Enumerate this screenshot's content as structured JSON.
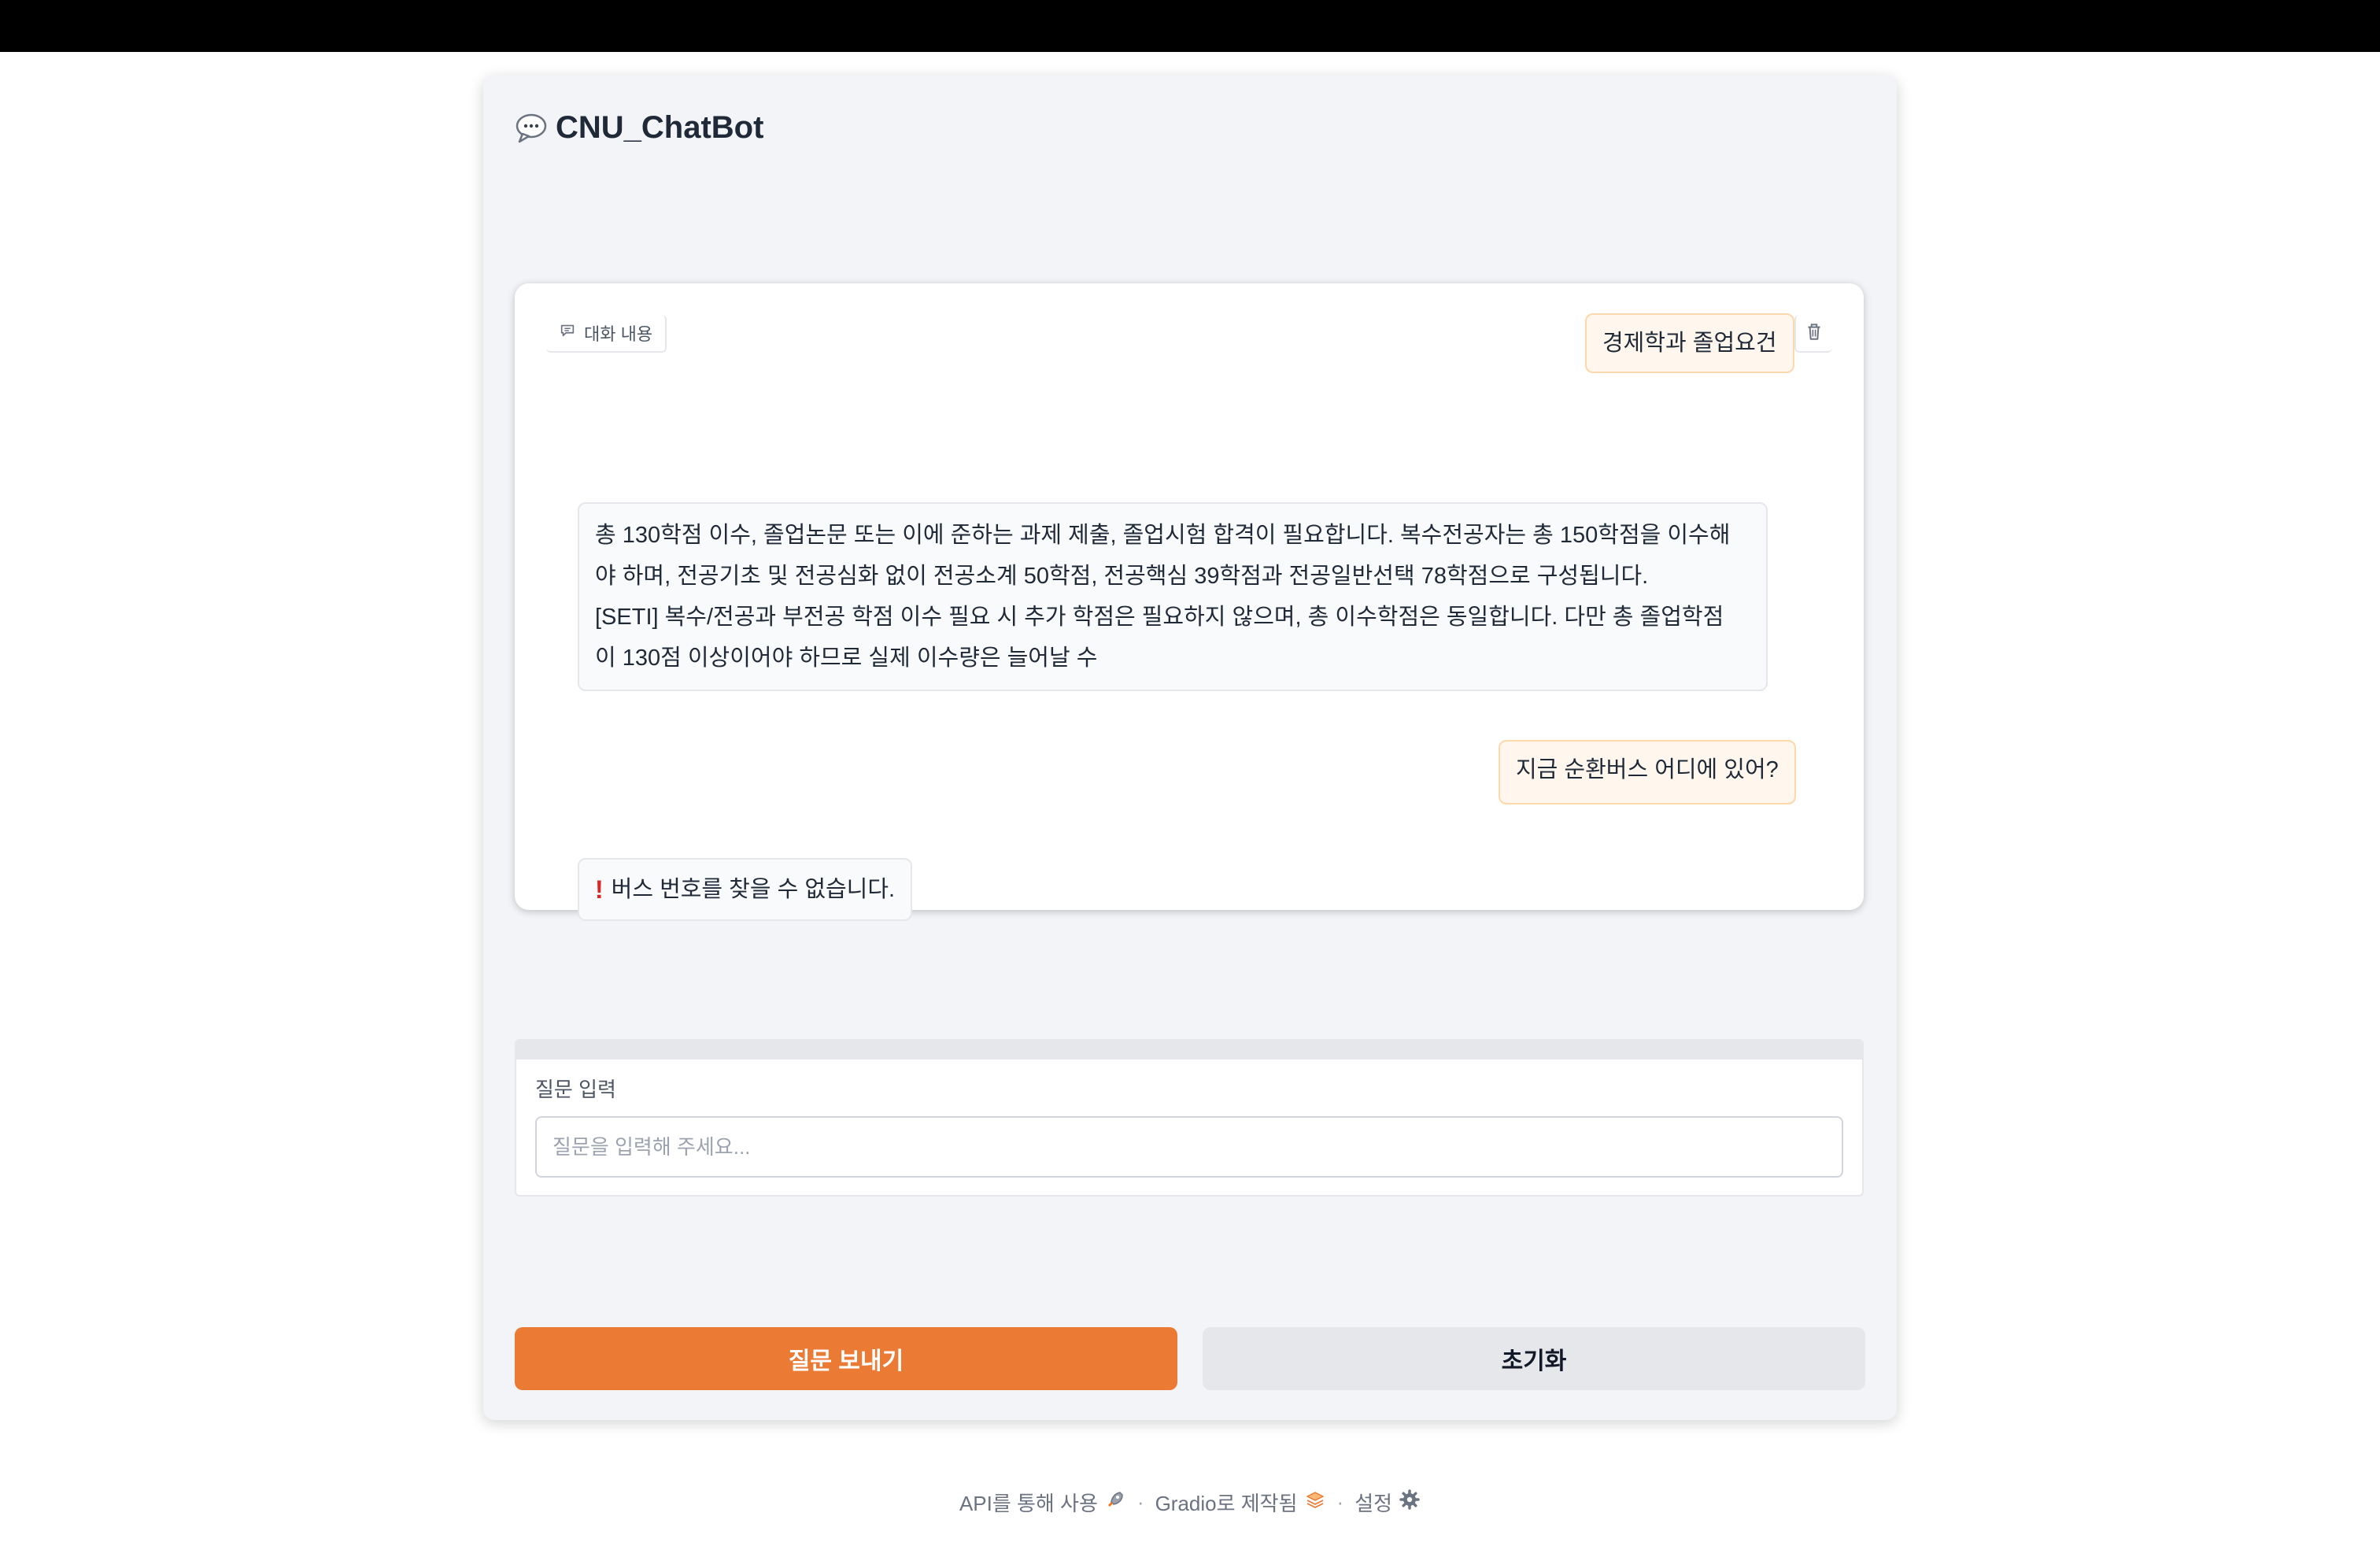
{
  "app": {
    "title": "CNU_ChatBot",
    "title_icon": "speech-bubble-icon"
  },
  "chat": {
    "label": "대화 내용",
    "label_icon": "chat-icon",
    "clear_icon": "trash-icon",
    "messages": [
      {
        "role": "user",
        "text": "경제학과 졸업요건"
      },
      {
        "role": "bot",
        "lines": [
          "총 130학점 이수, 졸업논문 또는 이에 준하는 과제 제출, 졸업시험 합격이 필요합니다. 복수전공자는 총 150학점을 이수해",
          "야 하며, 전공기초 및 전공심화 없이 전공소계 50학점, 전공핵심 39학점과 전공일반선택 78학점으로 구성됩니다.",
          "[SETI] 복수/전공과 부전공 학점 이수 필요 시 추가 학점은 필요하지 않으며, 총 이수학점은 동일합니다. 다만 총 졸업학점",
          "이 130점 이상이어야 하므로 실제 이수량은 늘어날 수"
        ]
      },
      {
        "role": "user",
        "text": "지금 순환버스 어디에 있어?"
      },
      {
        "role": "bot",
        "warn": "!",
        "text": "버스 번호를 찾을 수 없습니다."
      }
    ]
  },
  "input": {
    "label": "질문 입력",
    "placeholder": "질문을 입력해 주세요...",
    "value": ""
  },
  "buttons": {
    "send": "질문 보내기",
    "reset": "초기화"
  },
  "footer": {
    "api": "API를 통해 사용",
    "api_icon": "rocket-icon",
    "sep": "·",
    "gradio": "Gradio로 제작됨",
    "gradio_icon": "gradio-logo-icon",
    "settings": "설정",
    "settings_icon": "gear-icon"
  },
  "colors": {
    "accent": "#ea7a34",
    "user_bubble": "#fff7ed",
    "user_border": "#fed7aa",
    "warn": "#dc2626"
  }
}
